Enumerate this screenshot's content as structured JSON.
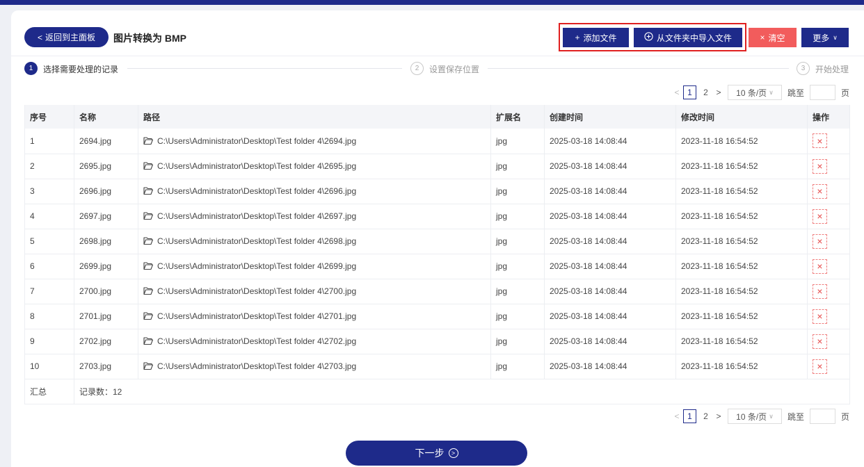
{
  "header": {
    "back_label": "返回到主面板",
    "back_icon": "chevron-left-icon",
    "title": "图片转换为 BMP",
    "add_label": "添加文件",
    "import_label": "从文件夹中导入文件",
    "clear_label": "清空",
    "more_label": "更多"
  },
  "steps": [
    {
      "num": "1",
      "label": "选择需要处理的记录"
    },
    {
      "num": "2",
      "label": "设置保存位置"
    },
    {
      "num": "3",
      "label": "开始处理"
    }
  ],
  "pager": {
    "prev": "<",
    "page1": "1",
    "page2": "2",
    "next": ">",
    "page_size": "10 条/页",
    "jump_label": "跳至",
    "jump_value": "",
    "unit": "页"
  },
  "table": {
    "columns": [
      "序号",
      "名称",
      "路径",
      "扩展名",
      "创建时间",
      "修改时间",
      "操作"
    ],
    "rows": [
      {
        "no": "1",
        "name": "2694.jpg",
        "path": "C:\\Users\\Administrator\\Desktop\\Test folder 4\\2694.jpg",
        "ext": "jpg",
        "created": "2025-03-18 14:08:44",
        "modified": "2023-11-18 16:54:52"
      },
      {
        "no": "2",
        "name": "2695.jpg",
        "path": "C:\\Users\\Administrator\\Desktop\\Test folder 4\\2695.jpg",
        "ext": "jpg",
        "created": "2025-03-18 14:08:44",
        "modified": "2023-11-18 16:54:52"
      },
      {
        "no": "3",
        "name": "2696.jpg",
        "path": "C:\\Users\\Administrator\\Desktop\\Test folder 4\\2696.jpg",
        "ext": "jpg",
        "created": "2025-03-18 14:08:44",
        "modified": "2023-11-18 16:54:52"
      },
      {
        "no": "4",
        "name": "2697.jpg",
        "path": "C:\\Users\\Administrator\\Desktop\\Test folder 4\\2697.jpg",
        "ext": "jpg",
        "created": "2025-03-18 14:08:44",
        "modified": "2023-11-18 16:54:52"
      },
      {
        "no": "5",
        "name": "2698.jpg",
        "path": "C:\\Users\\Administrator\\Desktop\\Test folder 4\\2698.jpg",
        "ext": "jpg",
        "created": "2025-03-18 14:08:44",
        "modified": "2023-11-18 16:54:52"
      },
      {
        "no": "6",
        "name": "2699.jpg",
        "path": "C:\\Users\\Administrator\\Desktop\\Test folder 4\\2699.jpg",
        "ext": "jpg",
        "created": "2025-03-18 14:08:44",
        "modified": "2023-11-18 16:54:52"
      },
      {
        "no": "7",
        "name": "2700.jpg",
        "path": "C:\\Users\\Administrator\\Desktop\\Test folder 4\\2700.jpg",
        "ext": "jpg",
        "created": "2025-03-18 14:08:44",
        "modified": "2023-11-18 16:54:52"
      },
      {
        "no": "8",
        "name": "2701.jpg",
        "path": "C:\\Users\\Administrator\\Desktop\\Test folder 4\\2701.jpg",
        "ext": "jpg",
        "created": "2025-03-18 14:08:44",
        "modified": "2023-11-18 16:54:52"
      },
      {
        "no": "9",
        "name": "2702.jpg",
        "path": "C:\\Users\\Administrator\\Desktop\\Test folder 4\\2702.jpg",
        "ext": "jpg",
        "created": "2025-03-18 14:08:44",
        "modified": "2023-11-18 16:54:52"
      },
      {
        "no": "10",
        "name": "2703.jpg",
        "path": "C:\\Users\\Administrator\\Desktop\\Test folder 4\\2703.jpg",
        "ext": "jpg",
        "created": "2025-03-18 14:08:44",
        "modified": "2023-11-18 16:54:52"
      }
    ],
    "summary_label": "汇总",
    "summary_count": "记录数：12"
  },
  "footer": {
    "next_label": "下一步"
  },
  "colors": {
    "brand": "#1e2a8a",
    "danger": "#f25c5c",
    "annotation": "#e02020"
  }
}
